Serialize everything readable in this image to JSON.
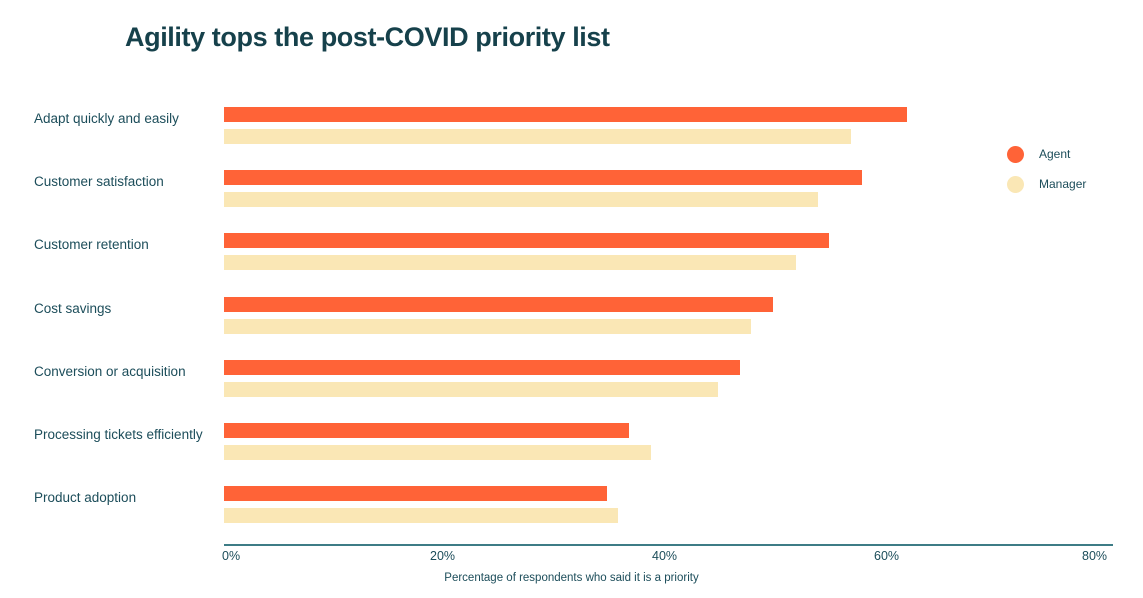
{
  "chart_data": {
    "type": "bar",
    "orientation": "horizontal",
    "title": "Agility tops the post-COVID priority list",
    "xlabel": "Percentage of respondents who said it is a priority",
    "ylabel": "",
    "xlim": [
      0,
      80
    ],
    "xticks": [
      "0%",
      "20%",
      "40%",
      "60%",
      "80%"
    ],
    "xtick_values": [
      0,
      20,
      40,
      60,
      80
    ],
    "grid": false,
    "legend_position": "right",
    "categories": [
      "Adapt quickly and easily",
      "Customer satisfaction",
      "Customer retention",
      "Cost savings",
      "Conversion or acquisition",
      "Processing tickets efficiently",
      "Product adoption"
    ],
    "series": [
      {
        "name": "Agent",
        "color": "#ff6337",
        "values": [
          61.5,
          57.5,
          54.5,
          49.5,
          46.5,
          36.5,
          34.5
        ]
      },
      {
        "name": "Manager",
        "color": "#fae7b5",
        "values": [
          56.5,
          53.5,
          51.5,
          47.5,
          44.5,
          38.5,
          35.5
        ]
      }
    ]
  },
  "colors": {
    "title": "#16414b",
    "text": "#1c4d5a",
    "axis": "#3d7c86",
    "agent": "#ff6337",
    "manager": "#fae7b5",
    "background": "#ffffff"
  }
}
